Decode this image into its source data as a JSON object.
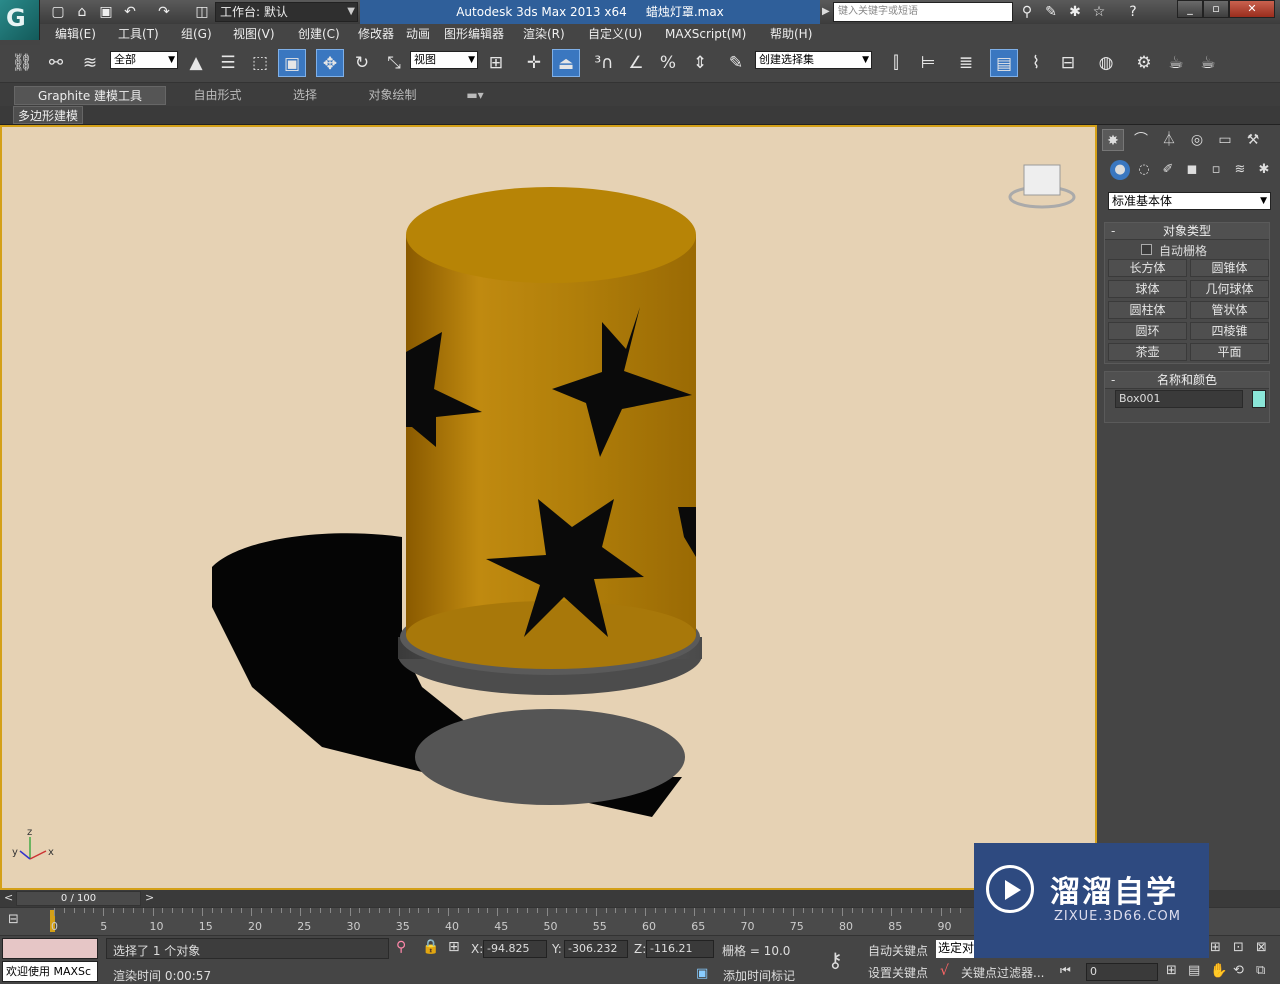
{
  "titlebar": {
    "workspace_label": "工作台: 默认",
    "app_title": "Autodesk 3ds Max  2013 x64",
    "file_name": "蜡烛灯罩.max",
    "search_placeholder": "键入关键字或短语"
  },
  "menubar": {
    "items": [
      "编辑(E)",
      "工具(T)",
      "组(G)",
      "视图(V)",
      "创建(C)",
      "修改器",
      "动画",
      "图形编辑器",
      "渲染(R)",
      "自定义(U)",
      "MAXScript(M)",
      "帮助(H)"
    ]
  },
  "toolbar": {
    "selection_filter": "全部",
    "reference_coord": "视图",
    "named_selection": "创建选择集"
  },
  "ribbon": {
    "tabs": [
      "Graphite 建模工具",
      "自由形式",
      "选择",
      "对象绘制"
    ],
    "active_panel": "多边形建模"
  },
  "command_panel": {
    "category": "标准基本体",
    "object_type": {
      "header": "对象类型",
      "autogrid_label": "自动栅格",
      "buttons": [
        "长方体",
        "圆锥体",
        "球体",
        "几何球体",
        "圆柱体",
        "管状体",
        "圆环",
        "四棱锥",
        "茶壶",
        "平面"
      ]
    },
    "name_color": {
      "header": "名称和颜色",
      "name_value": "Box001",
      "color": "#8ae6d8"
    }
  },
  "timeline": {
    "position_label": "0 / 100",
    "ticks": [
      "0",
      "5",
      "10",
      "15",
      "20",
      "25",
      "30",
      "35",
      "40",
      "45",
      "50",
      "55",
      "60",
      "65",
      "70",
      "75",
      "80",
      "85",
      "90"
    ]
  },
  "statusbar": {
    "welcome_text": "欢迎使用 MAXSc",
    "selection_status": "选择了 1 个对象",
    "render_time": "渲染时间 0:00:57",
    "x_value": "-94.825",
    "y_value": "-306.232",
    "z_value": "-116.21",
    "x_label": "X:",
    "y_label": "Y:",
    "z_label": "Z:",
    "grid_label": "栅格 = 10.0",
    "add_time_tag": "添加时间标记",
    "auto_key": "自动关键点",
    "set_key": "设置关键点",
    "selected_dd": "选定对",
    "key_filters": "关键点过滤器...",
    "frame_value": "0"
  },
  "watermark": {
    "title": "溜溜自学",
    "subtitle": "ZIXUE.3D66.COM"
  },
  "viewport": {
    "axis_x": "x",
    "axis_y": "y",
    "axis_z": "z"
  }
}
